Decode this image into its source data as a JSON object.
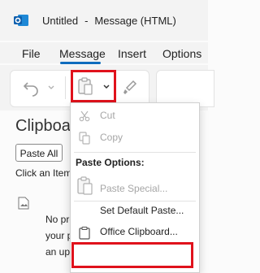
{
  "window": {
    "title": "Untitled",
    "separator": "-",
    "subtitle": "Message (HTML)"
  },
  "ribbon": {
    "tabs": [
      {
        "label": "File"
      },
      {
        "label": "Message"
      },
      {
        "label": "Insert"
      },
      {
        "label": "Options"
      }
    ],
    "active_tab": "Message"
  },
  "clipboard_pane": {
    "title": "Clipboard",
    "paste_all_label": "Paste All",
    "hint": "Click an Item to Paste:",
    "item_text": [
      "No previ",
      "your pi",
      "an upd"
    ]
  },
  "paste_menu": {
    "cut_label": "Cut",
    "copy_label": "Copy",
    "paste_options_header": "Paste Options:",
    "paste_special_label": "Paste Special...",
    "set_default_paste_label": "Set Default Paste...",
    "office_clipboard_label": "Office Clipboard..."
  },
  "colors": {
    "accent": "#0f6cbd",
    "highlight": "#e0121c",
    "disabled_text": "#a6a6a6"
  }
}
